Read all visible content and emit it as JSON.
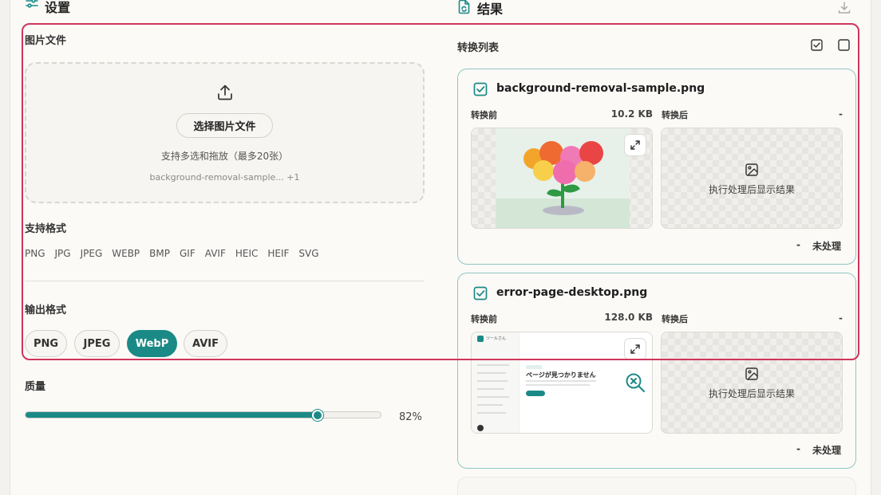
{
  "settings": {
    "title": "设置",
    "file_section": {
      "label": "图片文件",
      "select_button": "选择图片文件",
      "hint": "支持多选和拖放（最多20张）",
      "selected_files": "background-removal-sample... +1"
    },
    "supported": {
      "label": "支持格式",
      "formats": [
        "PNG",
        "JPG",
        "JPEG",
        "WEBP",
        "BMP",
        "GIF",
        "AVIF",
        "HEIC",
        "HEIF",
        "SVG"
      ]
    },
    "output": {
      "label": "输出格式",
      "options": [
        "PNG",
        "JPEG",
        "WebP",
        "AVIF"
      ],
      "selected": "WebP"
    },
    "quality": {
      "label": "质量",
      "value": 82,
      "value_text": "82%"
    }
  },
  "results": {
    "title": "结果",
    "list_label": "转换列表",
    "items": [
      {
        "filename": "background-removal-sample.png",
        "before_label": "转换前",
        "before_size": "10.2 KB",
        "after_label": "转换后",
        "after_size": "-",
        "placeholder": "执行处理后显示结果",
        "status_size": "-",
        "status": "未处理"
      },
      {
        "filename": "error-page-desktop.png",
        "before_label": "转换前",
        "before_size": "128.0 KB",
        "after_label": "转换后",
        "after_size": "-",
        "placeholder": "执行处理后显示结果",
        "status_size": "-",
        "status": "未处理"
      }
    ],
    "thumb2": {
      "app_name": "ツールさん",
      "heading": "ページが見つかりません",
      "button": "ホームへ戻る"
    }
  },
  "colors": {
    "accent": "#1b8a86",
    "highlight": "#d0355a"
  }
}
